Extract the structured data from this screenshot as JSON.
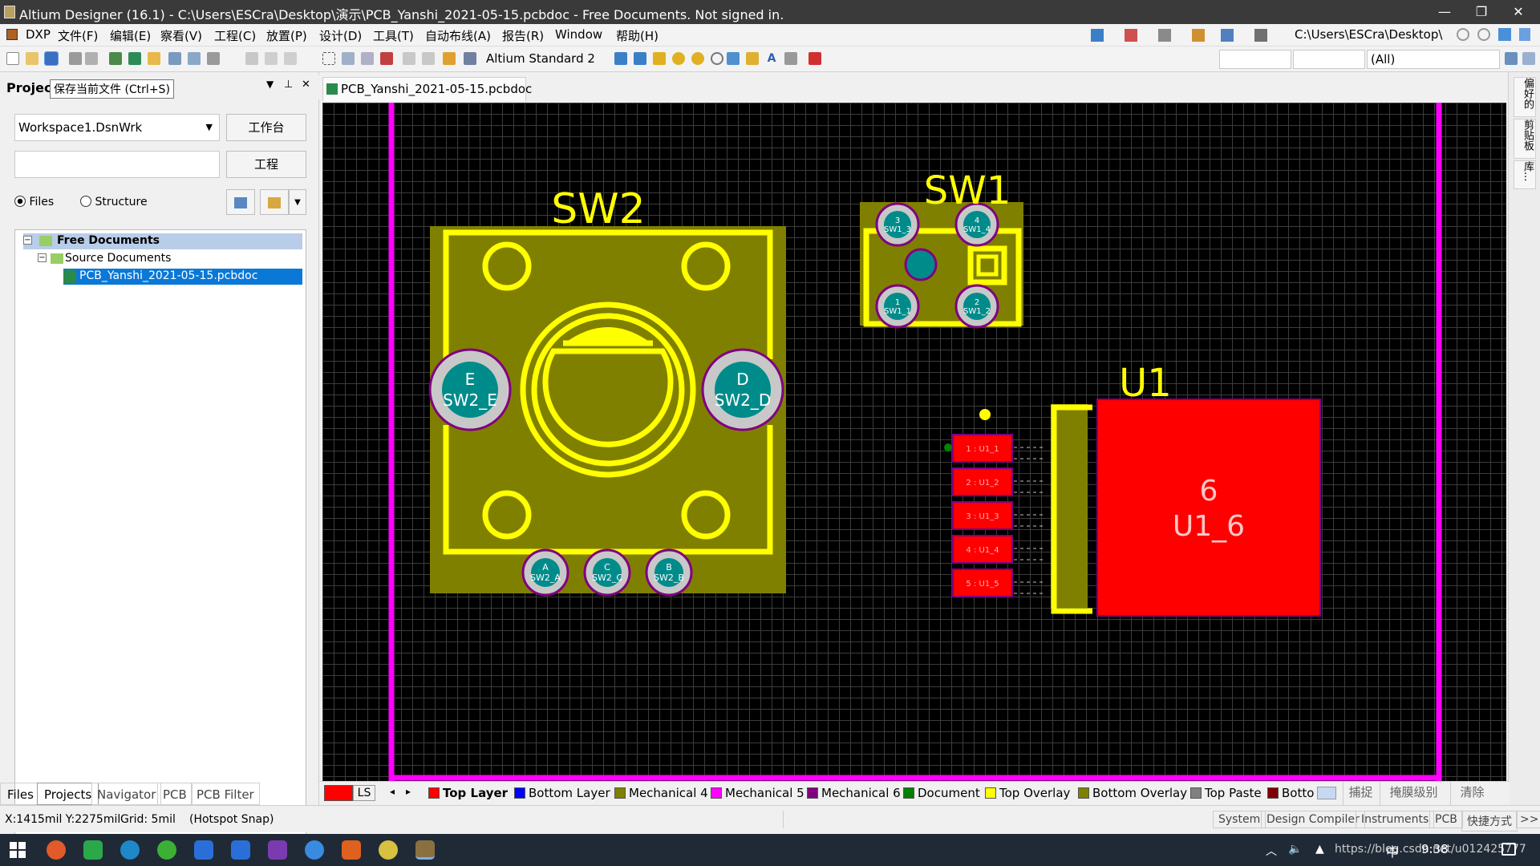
{
  "window": {
    "title": "Altium Designer (16.1) - C:\\Users\\ESCra\\Desktop\\演示\\PCB_Yanshi_2021-05-15.pcbdoc - Free Documents. Not signed in.",
    "minimize": "—",
    "maximize": "❐",
    "close": "✕"
  },
  "menu": [
    "DXP",
    "文件(F)",
    "编辑(E)",
    "察看(V)",
    "工程(C)",
    "放置(P)",
    "设计(D)",
    "工具(T)",
    "自动布线(A)",
    "报告(R)",
    "Window",
    "帮助(H)"
  ],
  "menu_path": "C:\\Users\\ESCra\\Desktop\\",
  "toolbar": {
    "view_config": "Altium Standard 2",
    "filter_all": "(All)",
    "filter_a": "",
    "filter_b": ""
  },
  "panel": {
    "title": "Projec",
    "tooltip": "保存当前文件 (Ctrl+S)",
    "workspace": "Workspace1.DsnWrk",
    "workspace_btn": "工作台",
    "project_field": "",
    "project_btn": "工程",
    "radio_files": "Files",
    "radio_structure": "Structure",
    "tree_root": "Free Documents",
    "tree_folder": "Source Documents",
    "tree_file": "PCB_Yanshi_2021-05-15.pcbdoc",
    "bottom_tabs": [
      "Files",
      "Projects",
      "Navigator",
      "PCB",
      "PCB Filter"
    ]
  },
  "doc_tab": "PCB_Yanshi_2021-05-15.pcbdoc",
  "right_strip": [
    "偏好的",
    "剪贴板",
    "库..."
  ],
  "pcb": {
    "sw2_label": "SW2",
    "sw1_label": "SW1",
    "u1_label": "U1",
    "sw2_pad_e": [
      "E",
      "SW2_E"
    ],
    "sw2_pad_d": [
      "D",
      "SW2_D"
    ],
    "sw2_pad_a": [
      "A",
      "SW2_A"
    ],
    "sw2_pad_c": [
      "C",
      "SW2_C"
    ],
    "sw2_pad_b": [
      "B",
      "SW2_B"
    ],
    "sw1_pads": [
      [
        "3",
        "SW1_3"
      ],
      [
        "4",
        "SW1_4"
      ],
      [
        "1",
        "SW1_1"
      ],
      [
        "2",
        "SW1_2"
      ]
    ],
    "u1_pads": [
      "1 : U1_1",
      "2 : U1_2",
      "3 : U1_3",
      "4 : U1_4",
      "5 : U1_5"
    ],
    "u1_big_pad": [
      "6",
      "U1_6"
    ]
  },
  "layers": {
    "current": "LS",
    "items": [
      {
        "name": "Top Layer",
        "color": "#ff0000"
      },
      {
        "name": "Bottom Layer",
        "color": "#0000ff"
      },
      {
        "name": "Mechanical 4",
        "color": "#808000"
      },
      {
        "name": "Mechanical 5",
        "color": "#ff00ff"
      },
      {
        "name": "Mechanical 6",
        "color": "#800080"
      },
      {
        "name": "Document",
        "color": "#008000"
      },
      {
        "name": "Top Overlay",
        "color": "#ffff00"
      },
      {
        "name": "Bottom Overlay",
        "color": "#808000"
      },
      {
        "name": "Top Paste",
        "color": "#808080"
      },
      {
        "name": "Botto",
        "color": "#800000"
      }
    ],
    "right_buttons": [
      "捕捉",
      "掩膜级别",
      "清除"
    ]
  },
  "status": {
    "coords": "X:1415mil Y:2275mil",
    "grid": "Grid: 5mil",
    "snap": "(Hotspot Snap)",
    "right_tabs": [
      "System",
      "Design Compiler",
      "Instruments",
      "PCB",
      "快捷方式",
      ">>"
    ]
  },
  "taskbar": {
    "tray_text": "https://blog.csdn.net/u012425777",
    "ime": "中",
    "time": "9:38"
  }
}
